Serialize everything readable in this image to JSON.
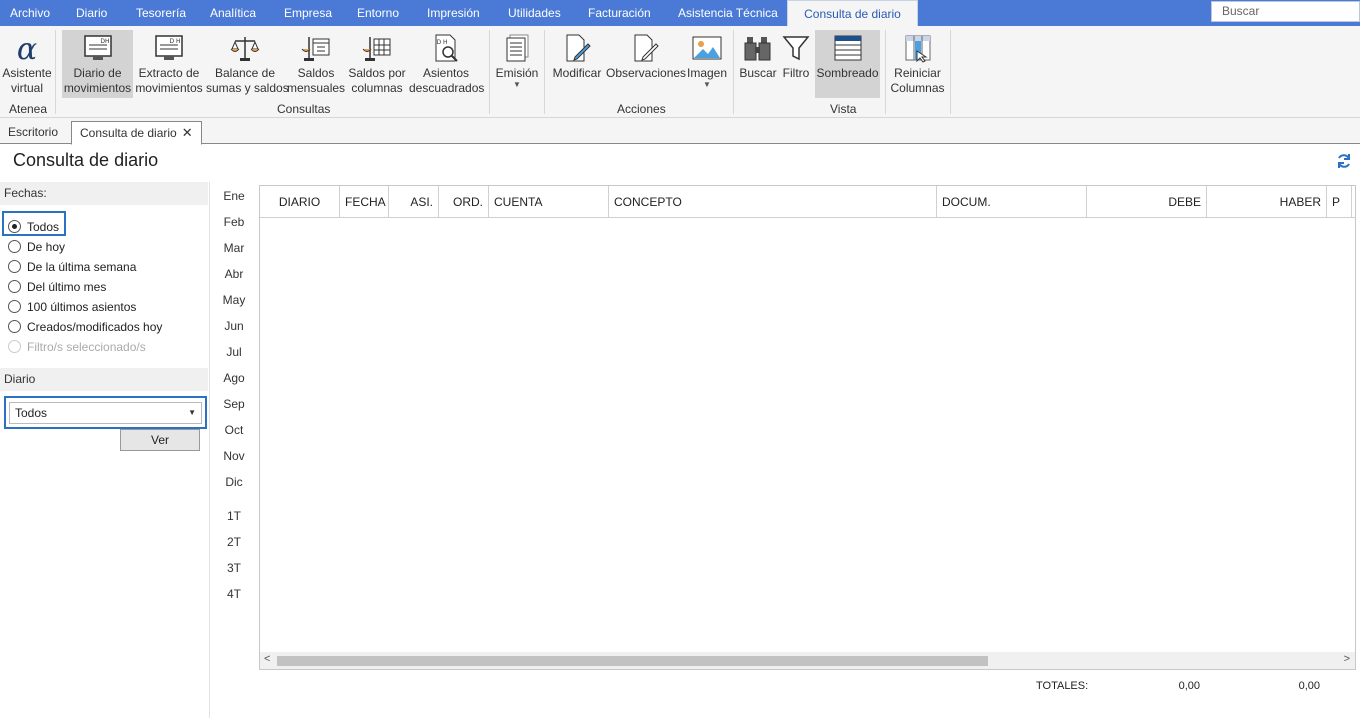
{
  "menu": {
    "items": [
      "Archivo",
      "Diario",
      "Tesorería",
      "Analítica",
      "Empresa",
      "Entorno",
      "Impresión",
      "Utilidades",
      "Facturación",
      "Asistencia Técnica",
      "Consulta de diario"
    ],
    "active": "Consulta de diario",
    "search_placeholder": "Buscar"
  },
  "ribbon": {
    "asistente": "Asistente virtual",
    "asistente_l1": "Asistente",
    "asistente_l2": "virtual",
    "diario_mov_l1": "Diario de",
    "diario_mov_l2": "movimientos",
    "extracto_l1": "Extracto de",
    "extracto_l2": "movimientos",
    "balance_l1": "Balance de",
    "balance_l2": "sumas y saldos",
    "saldos_mens_l1": "Saldos",
    "saldos_mens_l2": "mensuales",
    "saldos_col_l1": "Saldos por",
    "saldos_col_l2": "columnas",
    "asientos_l1": "Asientos",
    "asientos_l2": "descuadrados",
    "emision": "Emisión",
    "modificar": "Modificar",
    "observaciones": "Observaciones",
    "imagen": "Imagen",
    "buscar": "Buscar",
    "filtro": "Filtro",
    "sombreado": "Sombreado",
    "reiniciar_l1": "Reiniciar",
    "reiniciar_l2": "Columnas",
    "groups": {
      "atenea": "Atenea",
      "consultas": "Consultas",
      "acciones": "Acciones",
      "vista": "Vista"
    }
  },
  "tabs": {
    "escritorio": "Escritorio",
    "consulta": "Consulta de diario"
  },
  "page_title": "Consulta de diario",
  "filters": {
    "fechas_label": "Fechas:",
    "options": [
      "Todos",
      "De hoy",
      "De la última semana",
      "Del último mes",
      "100 últimos asientos",
      "Creados/modificados hoy",
      "Filtro/s seleccionado/s"
    ],
    "selected": "Todos",
    "diario_label": "Diario",
    "diario_value": "Todos",
    "ver_label": "Ver"
  },
  "months": [
    "Ene",
    "Feb",
    "Mar",
    "Abr",
    "May",
    "Jun",
    "Jul",
    "Ago",
    "Sep",
    "Oct",
    "Nov",
    "Dic"
  ],
  "quarters": [
    "1T",
    "2T",
    "3T",
    "4T"
  ],
  "grid": {
    "columns": [
      "DIARIO",
      "FECHA",
      "ASI.",
      "ORD.",
      "CUENTA",
      "CONCEPTO",
      "DOCUM.",
      "DEBE",
      "HABER",
      "P"
    ]
  },
  "totals": {
    "label": "TOTALES:",
    "debe": "0,00",
    "haber": "0,00"
  },
  "colors": {
    "menubar": "#4a7ad6",
    "accent": "#2a72c4"
  }
}
